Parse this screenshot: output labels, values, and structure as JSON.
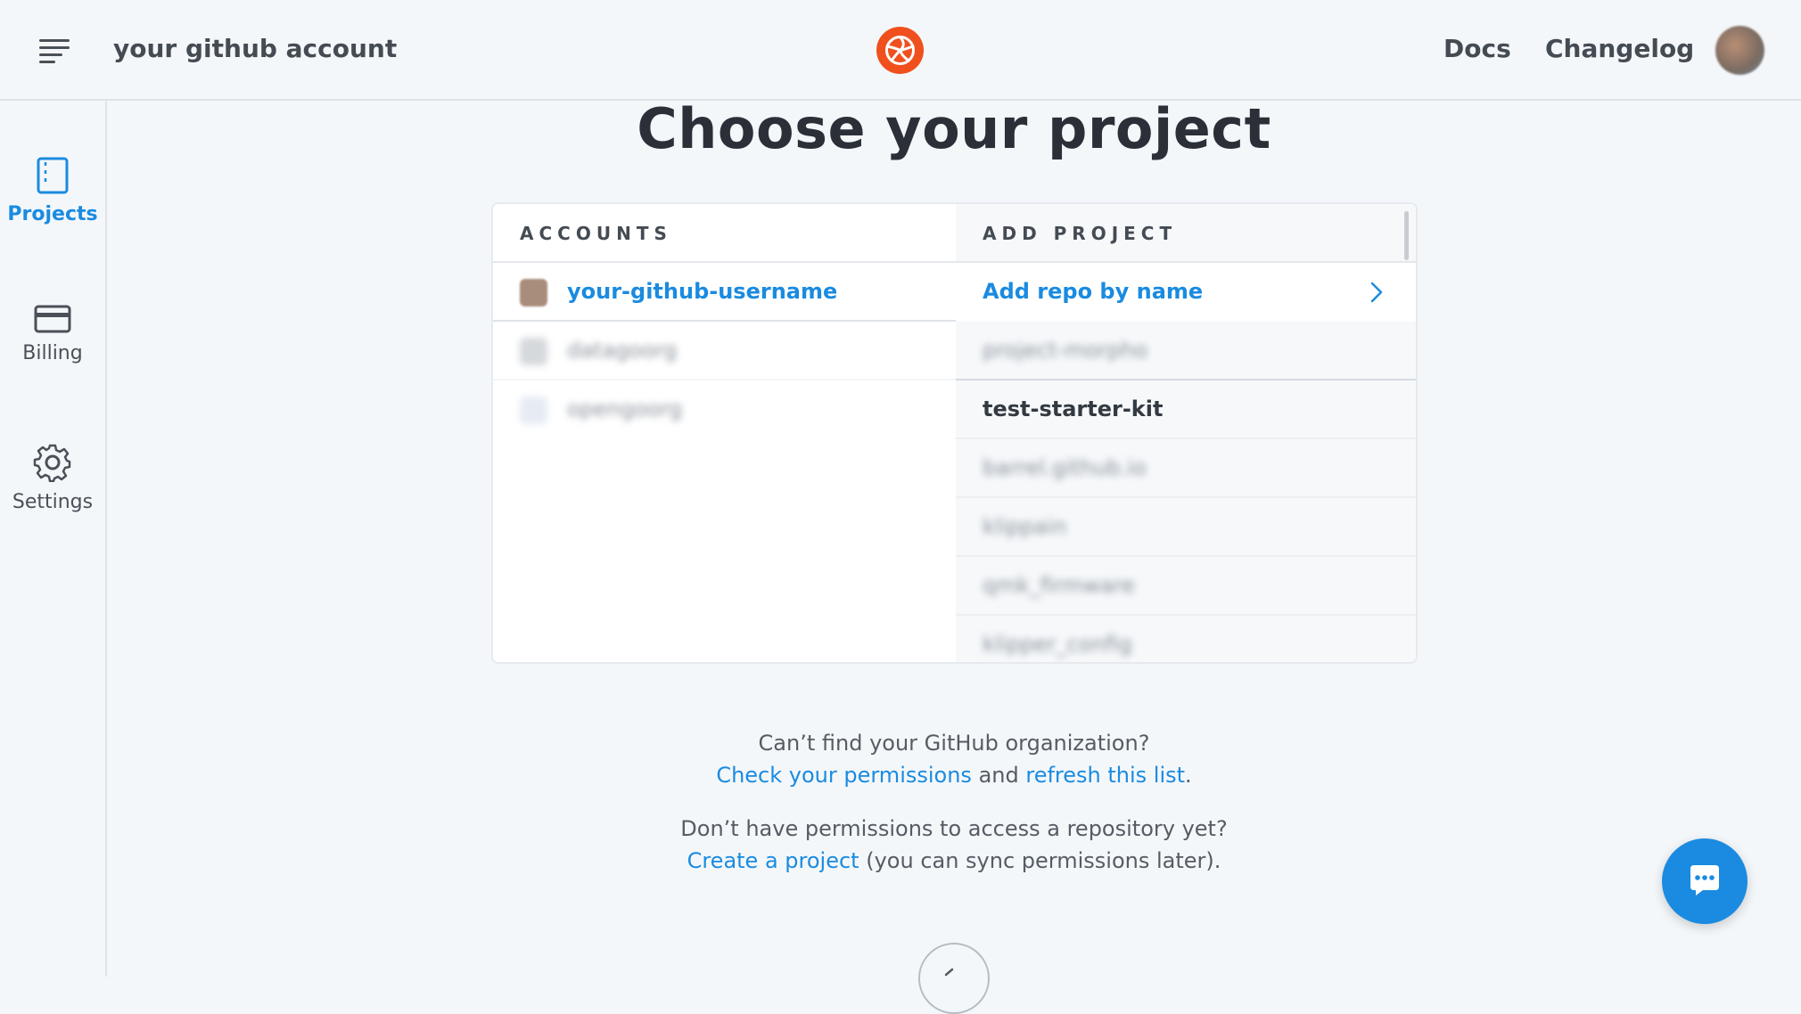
{
  "header": {
    "account_name": "your github account",
    "nav": [
      {
        "label": "Docs"
      },
      {
        "label": "Changelog"
      }
    ],
    "brand_color": "#f0501e"
  },
  "sidebar": {
    "items": [
      {
        "label": "Projects",
        "icon": "projects-icon",
        "active": true
      },
      {
        "label": "Billing",
        "icon": "credit-card-icon",
        "active": false
      },
      {
        "label": "Settings",
        "icon": "gear-icon",
        "active": false
      }
    ]
  },
  "page": {
    "title": "Choose your project"
  },
  "accounts": {
    "header": "ACCOUNTS",
    "items": [
      {
        "name": "your-github-username",
        "active": true,
        "blurred": false
      },
      {
        "name": "datagoorg",
        "active": false,
        "blurred": true
      },
      {
        "name": "opengoorg",
        "active": false,
        "blurred": true
      }
    ]
  },
  "projects": {
    "header": "ADD PROJECT",
    "add_repo_label": "Add repo by name",
    "repos": [
      {
        "name": "project-morpho",
        "blurred": true
      },
      {
        "name": "test-starter-kit",
        "blurred": false
      },
      {
        "name": "barrel.github.io",
        "blurred": true
      },
      {
        "name": "klippain",
        "blurred": true
      },
      {
        "name": "qmk_firmware",
        "blurred": true
      },
      {
        "name": "klipper_config",
        "blurred": true
      }
    ]
  },
  "help": {
    "org_question": "Can’t find your GitHub organization?",
    "check_permissions": "Check your permissions",
    "and": " and ",
    "refresh_list": "refresh this list",
    "period": ".",
    "repo_question": "Don’t have permissions to access a repository yet?",
    "create_project": "Create a project",
    "sync_later": " (you can sync permissions later)."
  },
  "colors": {
    "accent": "#1a8be0",
    "background": "#f4f7fa",
    "text": "#2b3038"
  }
}
